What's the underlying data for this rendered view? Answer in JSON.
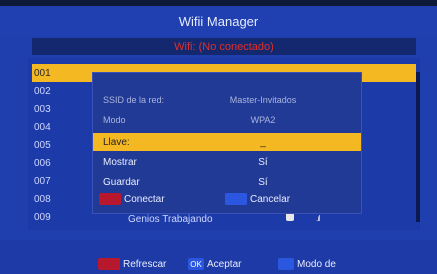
{
  "header": {
    "title": "Wifii Manager",
    "status": "Wifi: (No conectado)"
  },
  "list": {
    "rows": [
      "001",
      "002",
      "003",
      "004",
      "005",
      "006",
      "007",
      "008",
      "009"
    ],
    "partial_ssid": "Genios Trabajando"
  },
  "dialog": {
    "ssid_label": "SSID de la red:",
    "ssid_value": "Master-Invitados",
    "mode_label": "Modo",
    "mode_value": "WPA2",
    "key_label": "Llave:",
    "key_value": "_",
    "show_label": "Mostrar",
    "show_value": "Sí",
    "save_label": "Guardar",
    "save_value": "Sí",
    "connect_label": "Conectar",
    "cancel_label": "Cancelar"
  },
  "footer": {
    "refresh_label": "Refrescar",
    "ok_key": "OK",
    "accept_label": "Aceptar",
    "mode_label": "Modo de"
  },
  "colors": {
    "accent": "#f4b822",
    "background": "#1f3fae",
    "red_key": "#b8182e",
    "blue_key": "#2b56e0",
    "status_text": "#e0302a"
  }
}
